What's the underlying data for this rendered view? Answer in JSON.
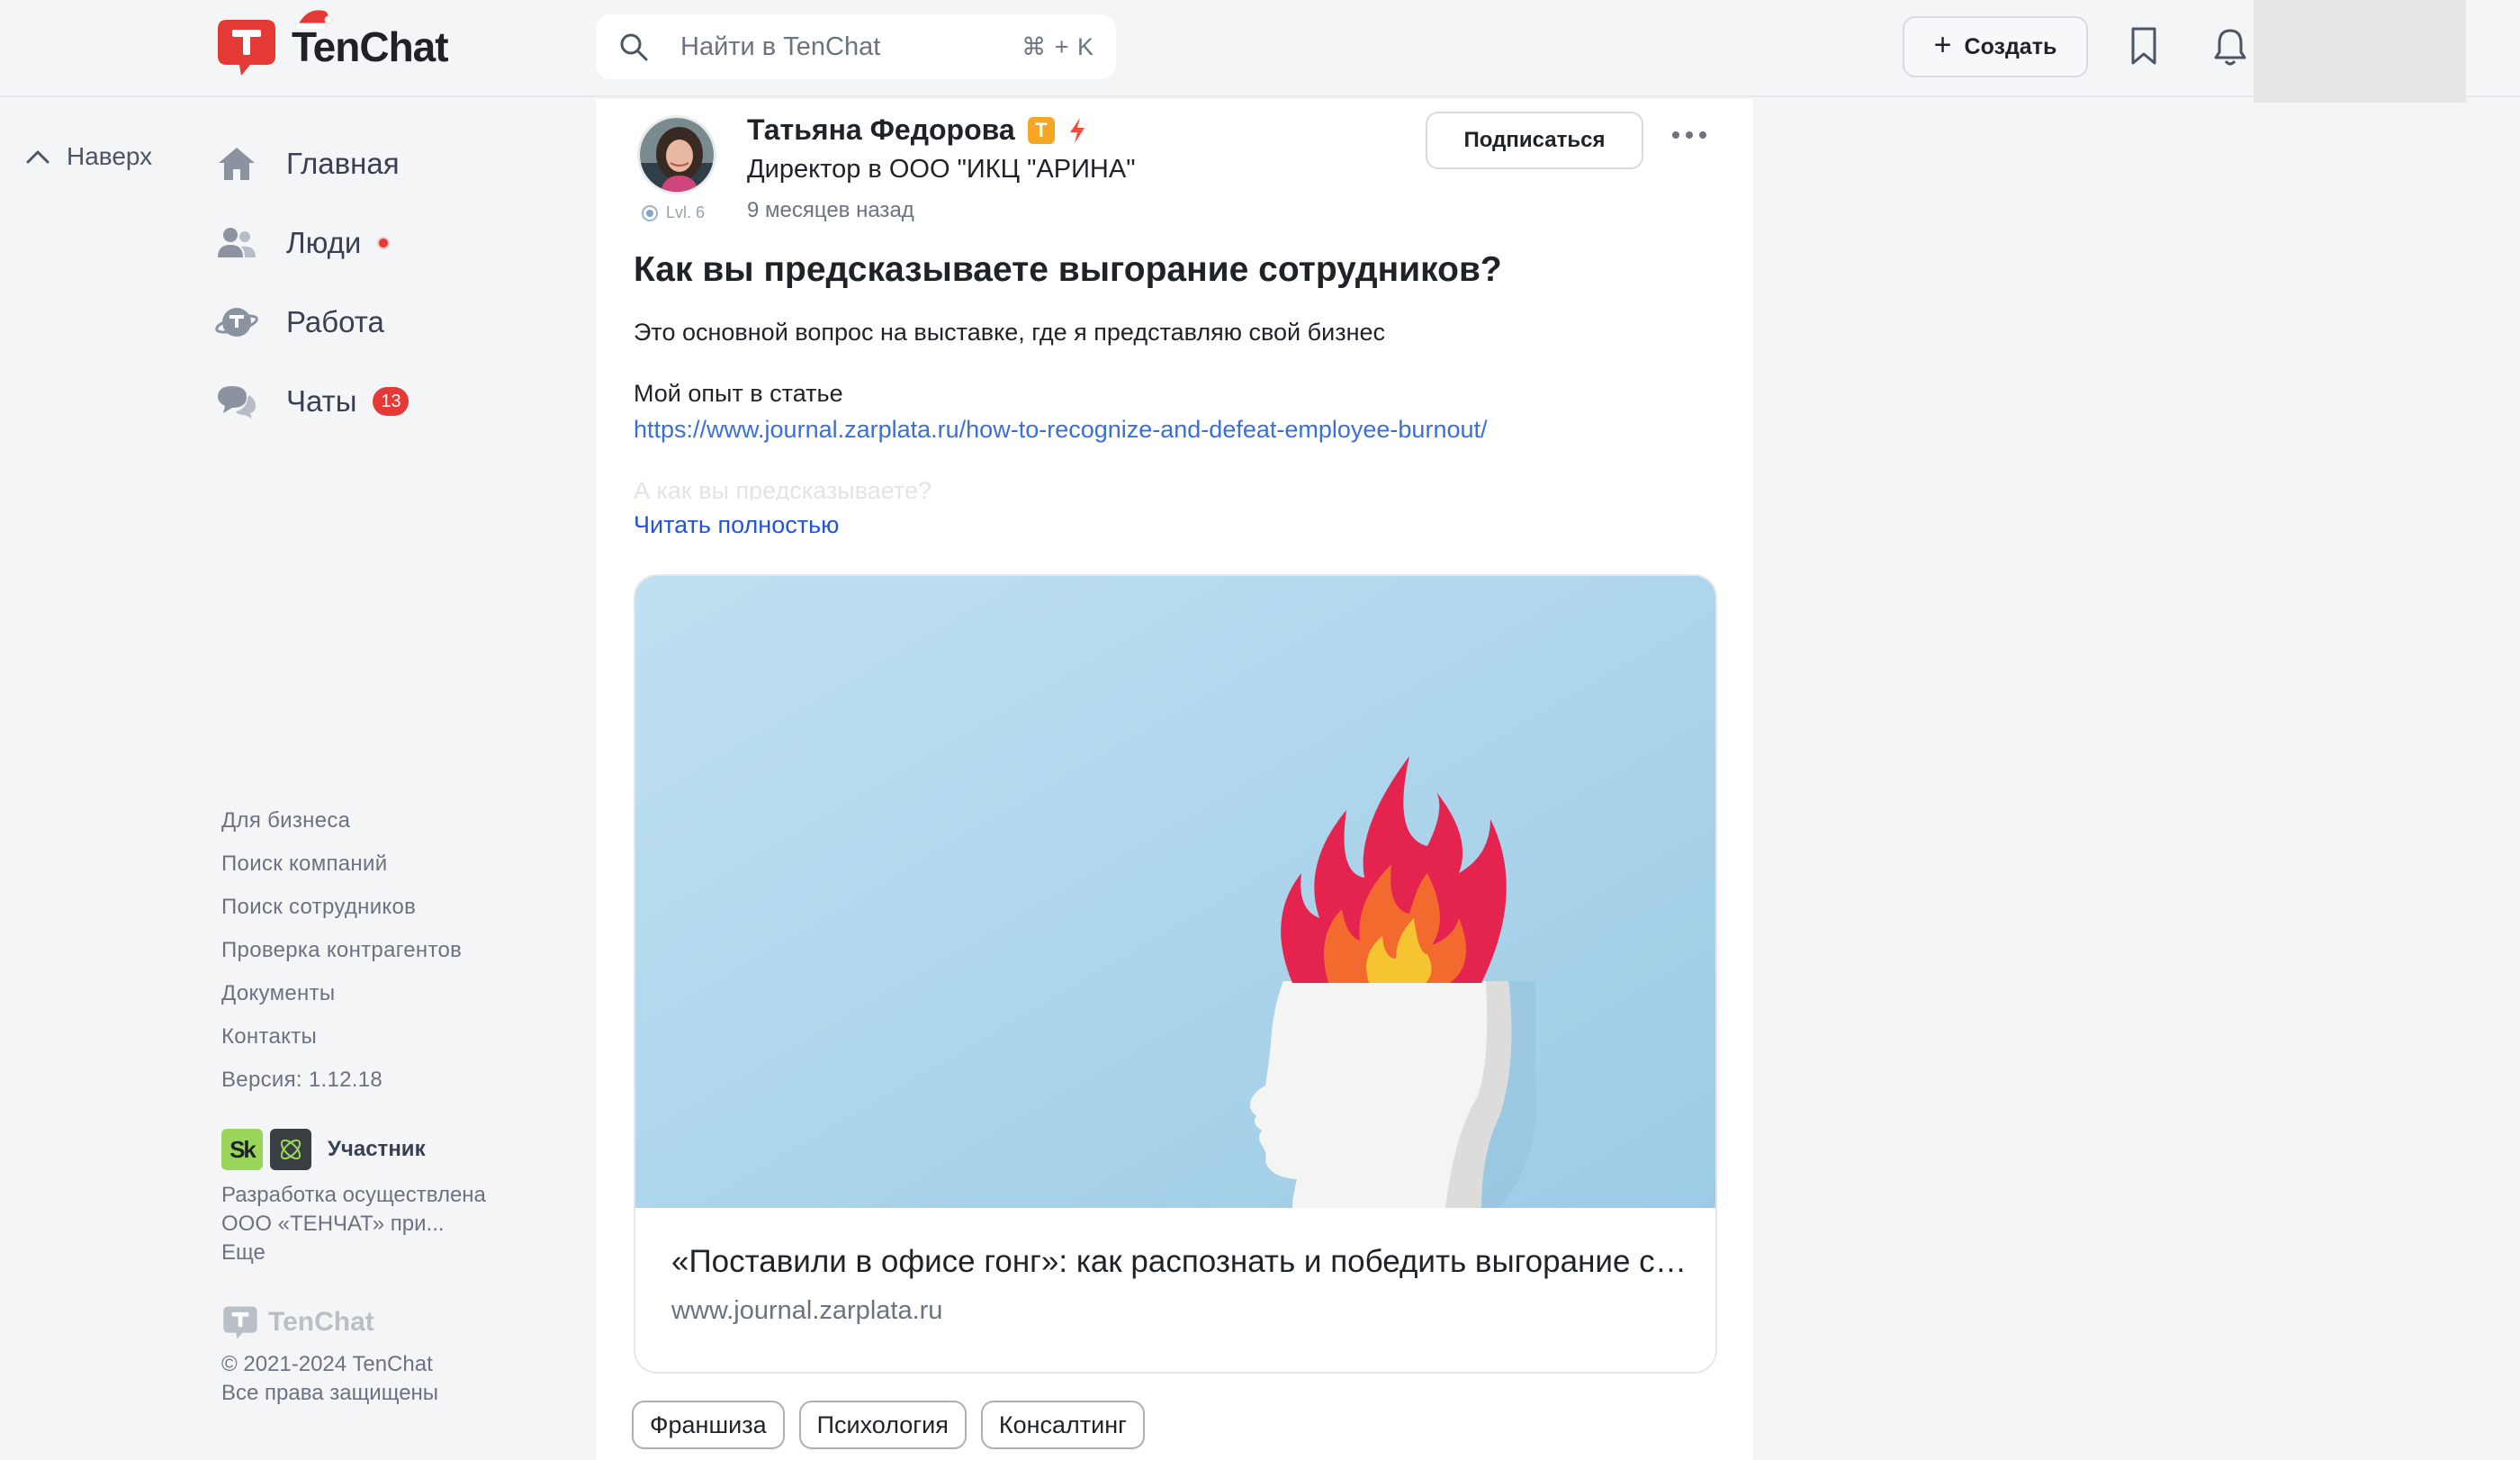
{
  "header": {
    "brand": "TenChat",
    "search_placeholder": "Найти в TenChat",
    "search_shortcut": "⌘ + K",
    "create_label": "Создать"
  },
  "back_to_top": "Наверх",
  "nav": {
    "items": [
      {
        "label": "Главная"
      },
      {
        "label": "Люди"
      },
      {
        "label": "Работа"
      },
      {
        "label": "Чаты",
        "badge": "13"
      }
    ]
  },
  "footer": {
    "links": [
      "Для бизнеса",
      "Поиск компаний",
      "Поиск сотрудников",
      "Проверка контрагентов",
      "Документы",
      "Контакты",
      "Версия: 1.12.18"
    ],
    "sk_label": "Участник",
    "dev_line1": "Разработка осуществлена",
    "dev_line2": "ООО «ТЕНЧАТ» при...",
    "dev_more": "Еще",
    "logo_text": "TenChat",
    "copyright_line1": "© 2021-2024 TenChat",
    "copyright_line2": "Все права защищены"
  },
  "post": {
    "author_name": "Татьяна Федорова",
    "author_position": "Директор в ООО \"ИКЦ \"АРИНА\"",
    "level": "Lvl. 6",
    "time": "9 месяцев назад",
    "subscribe_label": "Подписаться",
    "title": "Как вы предсказываете выгорание сотрудников?",
    "paragraph1": "Это основной вопрос на выставке, где я представляю свой бизнес",
    "paragraph2": "Мой опыт в статье",
    "link": "https://www.journal.zarplata.ru/how-to-recognize-and-defeat-employee-burnout/",
    "faded_text": "А как вы предсказываете?",
    "read_more": "Читать полностью",
    "preview_title": "«Поставили в офисе гонг»: как распознать и победить выгорание сотрудников",
    "preview_domain": "www.journal.zarplata.ru",
    "tags": [
      "Франшиза",
      "Психология",
      "Консалтинг"
    ]
  },
  "colors": {
    "brand_red": "#e53935",
    "link_blue": "#3b6fd8",
    "read_more_blue": "#2555d6",
    "badge_orange": "#f5a623"
  }
}
